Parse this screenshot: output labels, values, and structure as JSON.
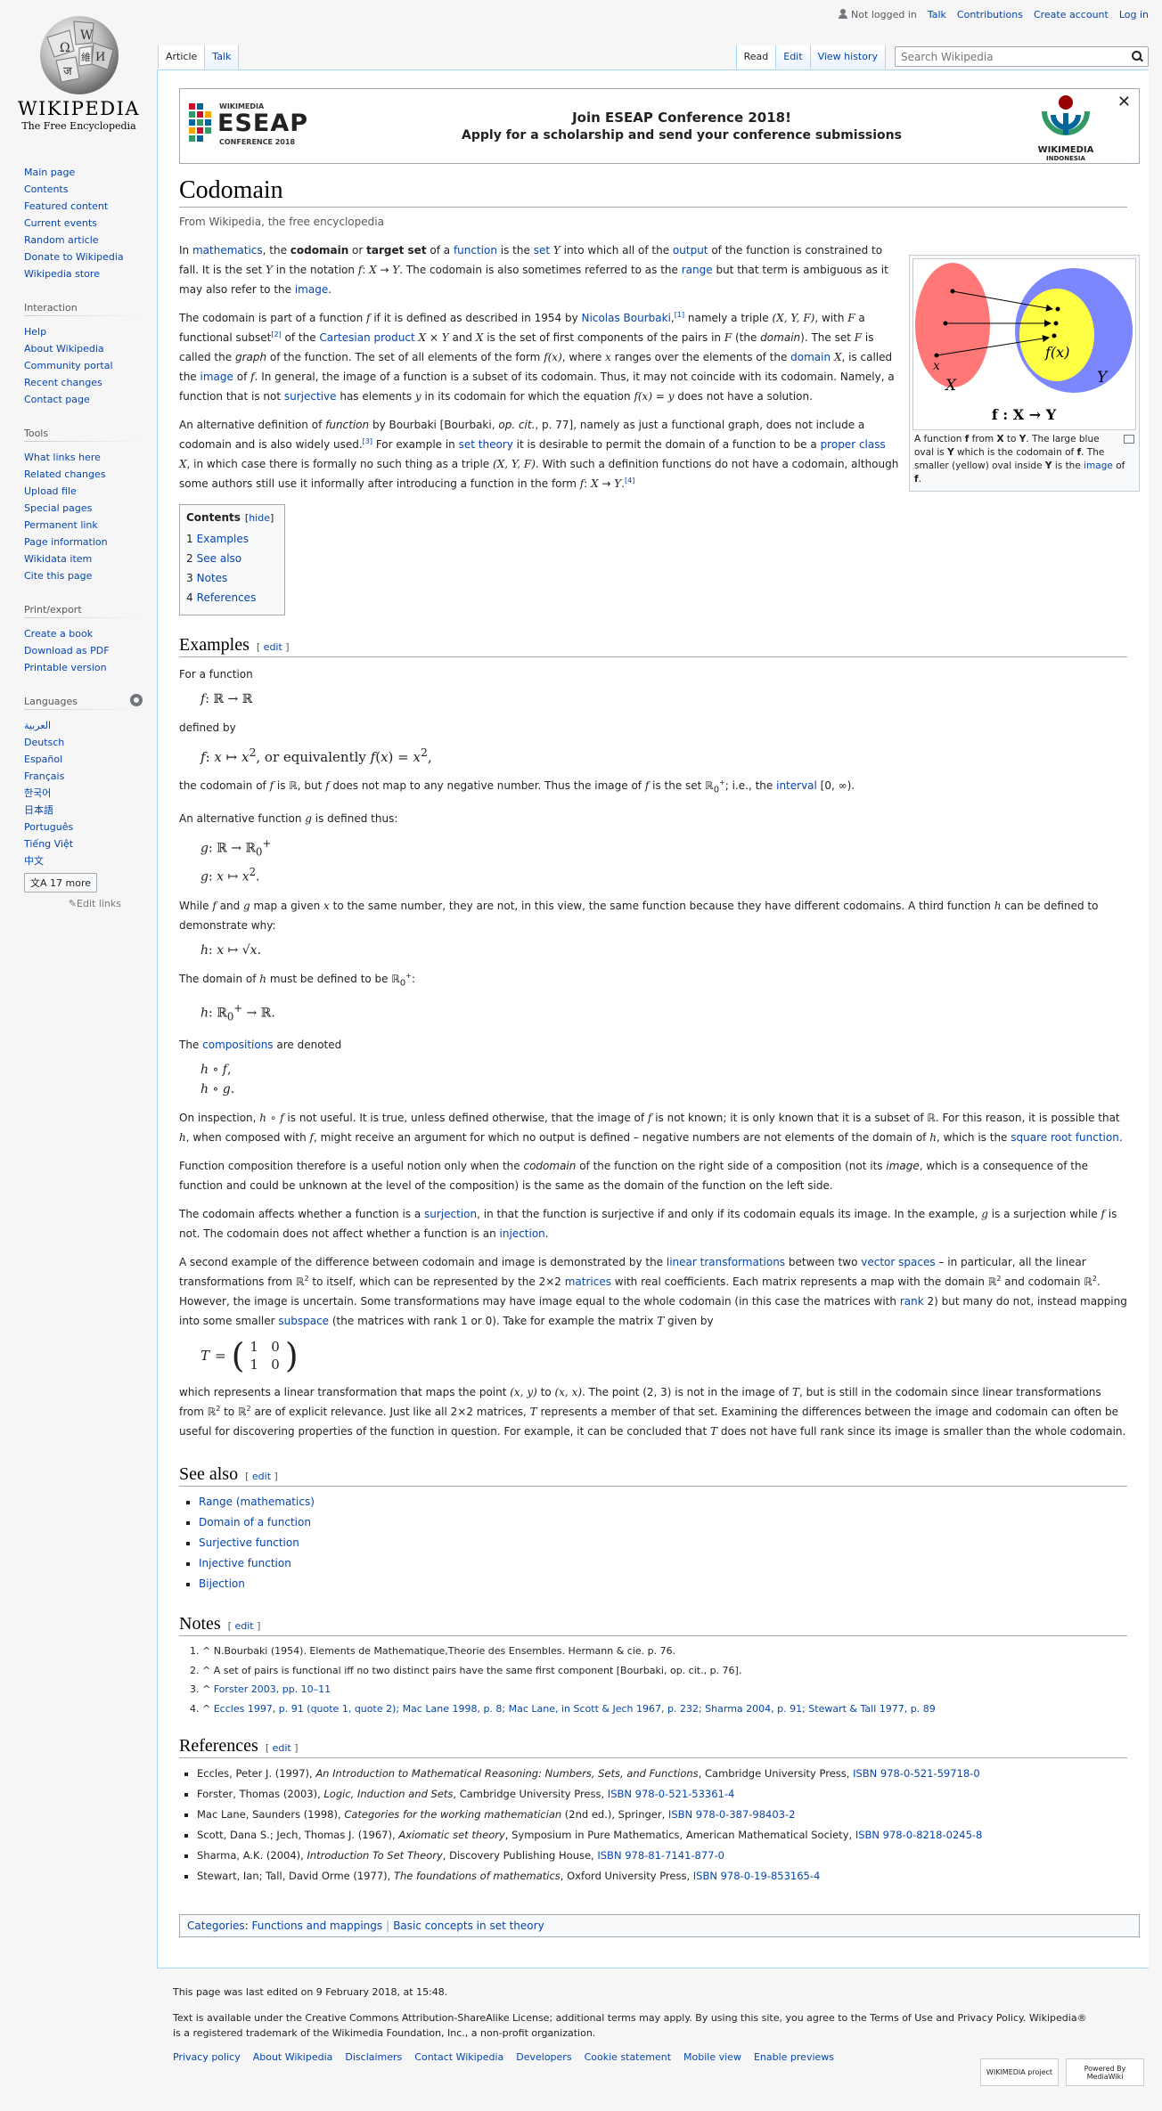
{
  "personal": {
    "not_logged_in": "Not logged in",
    "talk": "Talk",
    "contributions": "Contributions",
    "create_account": "Create account",
    "log_in": "Log in"
  },
  "logo": {
    "wordmark": "Wikipedia",
    "tagline": "The Free Encyclopedia"
  },
  "tabs": {
    "article": "Article",
    "talk": "Talk",
    "read": "Read",
    "edit": "Edit",
    "history": "View history",
    "search_placeholder": "Search Wikipedia"
  },
  "sidebar": {
    "navigation": [
      "Main page",
      "Contents",
      "Featured content",
      "Current events",
      "Random article",
      "Donate to Wikipedia",
      "Wikipedia store"
    ],
    "interaction_title": "Interaction",
    "interaction": [
      "Help",
      "About Wikipedia",
      "Community portal",
      "Recent changes",
      "Contact page"
    ],
    "tools_title": "Tools",
    "tools": [
      "What links here",
      "Related changes",
      "Upload file",
      "Special pages",
      "Permanent link",
      "Page information",
      "Wikidata item",
      "Cite this page"
    ],
    "print_title": "Print/export",
    "print": [
      "Create a book",
      "Download as PDF",
      "Printable version"
    ],
    "languages_title": "Languages",
    "languages": [
      "العربية",
      "Deutsch",
      "Español",
      "Français",
      "한국어",
      "日本語",
      "Português",
      "Tiếng Việt",
      "中文"
    ],
    "more_languages": "17 more",
    "edit_links": "Edit links"
  },
  "banner": {
    "logo_top": "WIKIMEDIA",
    "logo_main": "ESEAP",
    "logo_bottom": "CONFERENCE 2018",
    "line1": "Join ESEAP Conference 2018!",
    "line2": "Apply for a scholarship and send your conference submissions",
    "wm_label1": "WIKIMEDIA",
    "wm_label2": "INDONESIA"
  },
  "article": {
    "title": "Codomain",
    "site_sub": "From Wikipedia, the free encyclopedia",
    "figure": {
      "label_x_small": "x",
      "label_X": "X",
      "label_fx": "f(x)",
      "label_Y": "Y",
      "label_map": "f : X → Y",
      "caption": "A function f from X to Y. The large blue oval is Y which is the codomain of f. The smaller (yellow) oval inside Y is the image of f."
    },
    "toc": {
      "title": "Contents",
      "hide": "hide",
      "items": [
        {
          "num": "1",
          "label": "Examples"
        },
        {
          "num": "2",
          "label": "See also"
        },
        {
          "num": "3",
          "label": "Notes"
        },
        {
          "num": "4",
          "label": "References"
        }
      ]
    },
    "sections": {
      "examples": "Examples",
      "see_also": "See also",
      "notes": "Notes",
      "references": "References",
      "edit": "edit"
    },
    "ex_text": {
      "for_a_function": "For a function",
      "defined_by": "defined by",
      "alt_function": "An alternative function g is defined thus:",
      "compositions_denoted": "are denoted"
    },
    "see_also": [
      "Range (mathematics)",
      "Domain of a function",
      "Surjective function",
      "Injective function",
      "Bijection"
    ],
    "notes": [
      "N.Bourbaki (1954). Elements de Mathematique,Theorie des Ensembles. Hermann & cie. p. 76.",
      "A set of pairs is functional iff no two distinct pairs have the same first component [Bourbaki, op. cit., p. 76].",
      "Forster 2003, pp. 10–11",
      "Eccles 1997, p. 91 (quote 1, quote 2); Mac Lane 1998, p. 8; Mac Lane, in Scott & Jech 1967, p. 232; Sharma 2004, p. 91; Stewart & Tall 1977, p. 89"
    ],
    "references": [
      {
        "pre": "Eccles, Peter J. (1997), ",
        "title": "An Introduction to Mathematical Reasoning: Numbers, Sets, and Functions",
        "post": ", Cambridge University Press, ",
        "isbn": "ISBN 978-0-521-59718-0"
      },
      {
        "pre": "Forster, Thomas (2003), ",
        "title": "Logic, Induction and Sets",
        "post": ", Cambridge University Press, ",
        "isbn": "ISBN 978-0-521-53361-4"
      },
      {
        "pre": "Mac Lane, Saunders (1998), ",
        "title": "Categories for the working mathematician",
        "post": " (2nd ed.), Springer, ",
        "isbn": "ISBN 978-0-387-98403-2"
      },
      {
        "pre": "Scott, Dana S.; Jech, Thomas J. (1967), ",
        "title": "Axiomatic set theory",
        "post": ", Symposium in Pure Mathematics, American Mathematical Society, ",
        "isbn": "ISBN 978-0-8218-0245-8"
      },
      {
        "pre": "Sharma, A.K. (2004), ",
        "title": "Introduction To Set Theory",
        "post": ", Discovery Publishing House, ",
        "isbn": "ISBN 978-81-7141-877-0"
      },
      {
        "pre": "Stewart, Ian; Tall, David Orme (1977), ",
        "title": "The foundations of mathematics",
        "post": ", Oxford University Press, ",
        "isbn": "ISBN 978-0-19-853165-4"
      }
    ],
    "categories_label": "Categories",
    "categories": [
      "Functions and mappings",
      "Basic concepts in set theory"
    ]
  },
  "footer": {
    "last_edited": "This page was last edited on 9 February 2018, at 15:48.",
    "license": "Text is available under the Creative Commons Attribution-ShareAlike License; additional terms may apply. By using this site, you agree to the Terms of Use and Privacy Policy. Wikipedia® is a registered trademark of the Wikimedia Foundation, Inc., a non-profit organization.",
    "links": [
      "Privacy policy",
      "About Wikipedia",
      "Disclaimers",
      "Contact Wikipedia",
      "Developers",
      "Cookie statement",
      "Mobile view",
      "Enable previews"
    ],
    "icon_wikimedia": "WIKIMEDIA project",
    "icon_mediawiki": "Powered By MediaWiki"
  },
  "colors": {
    "link": "#0645ad",
    "tab_border": "#a7d7f9",
    "oval_x": "#ff7777",
    "oval_y": "#7b86ff",
    "oval_image": "#ffff44"
  }
}
